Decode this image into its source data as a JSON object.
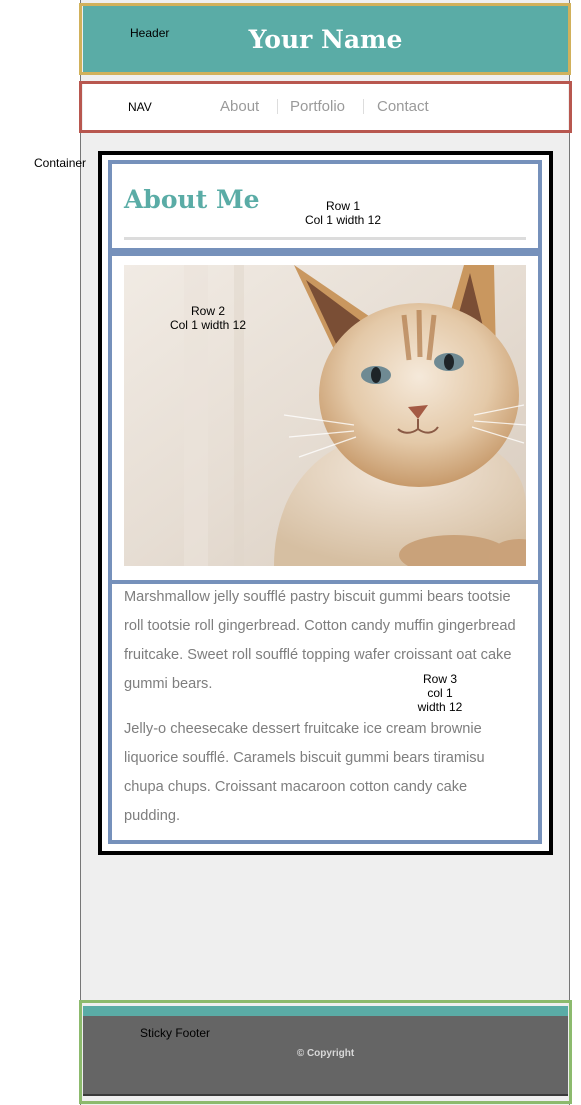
{
  "header": {
    "annotation": "Header",
    "title": "Your Name"
  },
  "nav": {
    "annotation": "NAV",
    "items": [
      {
        "label": "About"
      },
      {
        "label": "Portfolio"
      },
      {
        "label": "Contact"
      }
    ]
  },
  "container": {
    "annotation": "Container",
    "row1": {
      "title": "About Me",
      "annotation_line1": "Row 1",
      "annotation_line2": "Col 1 width 12"
    },
    "row2": {
      "annotation_line1": "Row 2",
      "annotation_line2": "Col 1 width 12",
      "image_icon": "cat-photo"
    },
    "row3": {
      "annotation_line1": "Row 3",
      "annotation_line2": "col 1",
      "annotation_line3": "width 12",
      "paragraph1": "Marshmallow jelly soufflé pastry biscuit gummi bears tootsie roll tootsie roll gingerbread. Cotton candy muffin gingerbread fruitcake. Sweet roll soufflé topping wafer croissant oat cake gummi bears.",
      "paragraph2": "Jelly-o cheesecake dessert fruitcake ice cream brownie liquorice soufflé. Caramels biscuit gummi bears tiramisu chupa chups. Croissant macaroon cotton candy cake pudding."
    }
  },
  "footer": {
    "annotation": "Sticky Footer",
    "copyright": "© Copyright"
  },
  "colors": {
    "teal": "#5aaca6",
    "header_outline": "#d1b15b",
    "nav_outline": "#b8574f",
    "row_outline": "#7691bb",
    "footer_outline": "#8cba6d",
    "footer_bg": "#656565"
  }
}
